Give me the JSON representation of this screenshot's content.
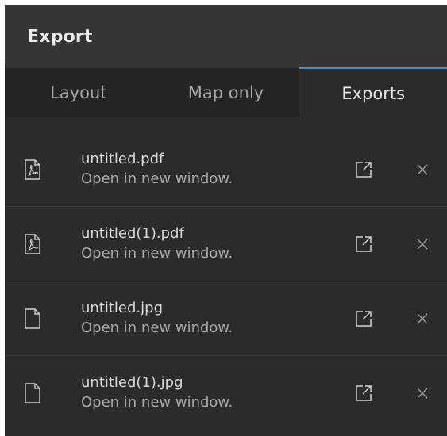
{
  "header": {
    "title": "Export"
  },
  "tabs": [
    {
      "label": "Layout",
      "active": false
    },
    {
      "label": "Map only",
      "active": false
    },
    {
      "label": "Exports",
      "active": true
    }
  ],
  "exports": [
    {
      "name": "untitled.pdf",
      "subtext": "Open in new window.",
      "icon": "pdf-file-icon"
    },
    {
      "name": "untitled(1).pdf",
      "subtext": "Open in new window.",
      "icon": "pdf-file-icon"
    },
    {
      "name": "untitled.jpg",
      "subtext": "Open in new window.",
      "icon": "file-icon"
    },
    {
      "name": "untitled(1).jpg",
      "subtext": "Open in new window.",
      "icon": "file-icon"
    }
  ],
  "colors": {
    "accent": "#3d8fd6",
    "panel": "#2b2b2b",
    "header": "#353535"
  }
}
